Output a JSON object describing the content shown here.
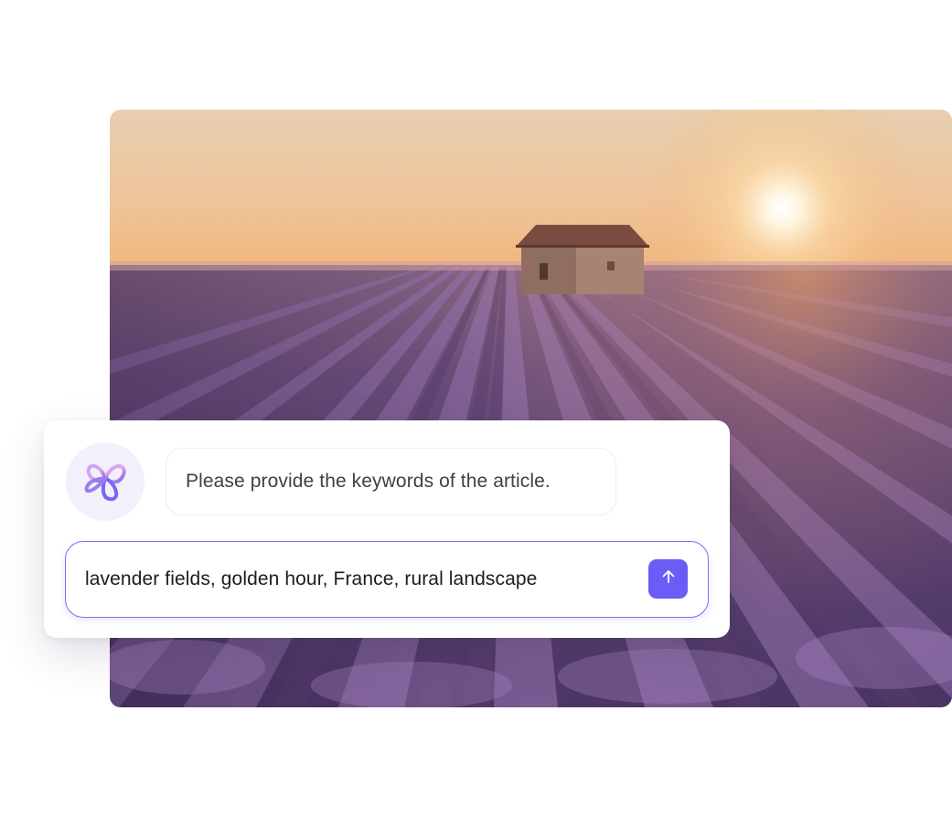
{
  "chat": {
    "assistant_message": "Please provide the keywords of the article.",
    "input_value": "lavender fields, golden hour, France, rural landscape",
    "avatar_icon": "assistant-logo-icon",
    "send_icon": "arrow-up-icon"
  },
  "photo": {
    "subject": "landscape-photo"
  },
  "colors": {
    "accent": "#6b5cf6",
    "input_border": "#7a6ef0",
    "avatar_bg": "#f2f1fb"
  }
}
